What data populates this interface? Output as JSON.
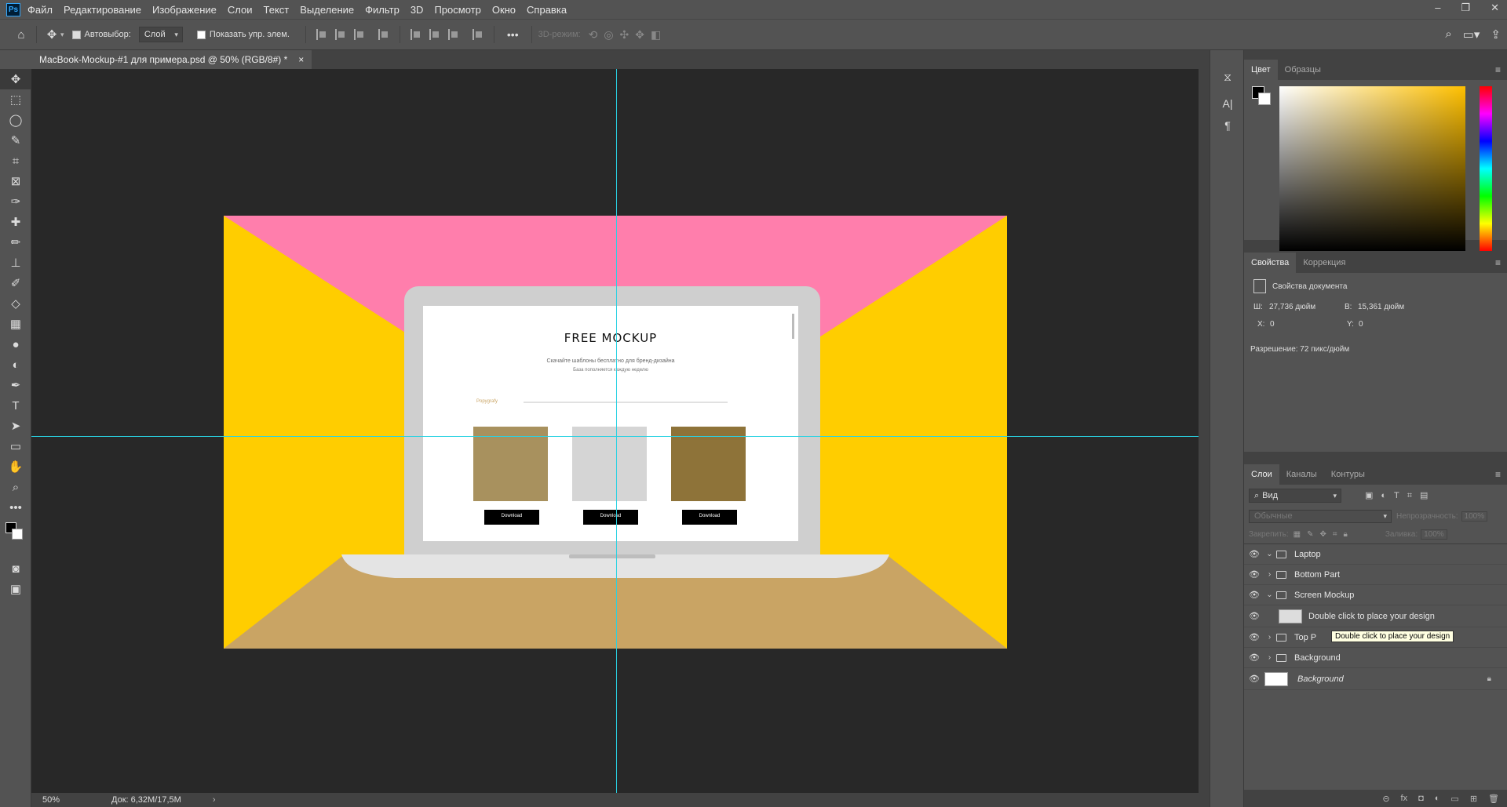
{
  "app": {
    "logo": "Ps"
  },
  "menu": [
    "Файл",
    "Редактирование",
    "Изображение",
    "Слои",
    "Текст",
    "Выделение",
    "Фильтр",
    "3D",
    "Просмотр",
    "Окно",
    "Справка"
  ],
  "window_controls": [
    "–",
    "❐",
    "✕"
  ],
  "options": {
    "auto_select_label": "Автовыбор:",
    "auto_select_value": "Слой",
    "show_controls_label": "Показать упр. элем.",
    "more": "•••",
    "mode3d_label": "3D-режим:"
  },
  "document_tab": {
    "title": "MacBook-Mockup-#1 для примера.psd @ 50% (RGB/8#) *",
    "close": "×"
  },
  "mockup": {
    "title": "FREE MOCKUP",
    "subtitle_1": "Скачайте шаблоны бесплатно для бренд-дизайна",
    "subtitle_2": "База пополняется каждую неделю",
    "section_label": "Popygrafy",
    "download_labels": [
      "Download",
      "Download",
      "Download"
    ]
  },
  "status": {
    "zoom": "50%",
    "doc_info": "Док: 6,32M/17,5M"
  },
  "color_panel": {
    "tabs": [
      "Цвет",
      "Образцы"
    ]
  },
  "properties_panel": {
    "tabs": [
      "Свойства",
      "Коррекция"
    ],
    "heading": "Свойства документа",
    "w_label": "Ш:",
    "w_value": "27,736 дюйм",
    "h_label": "В:",
    "h_value": "15,361 дюйм",
    "x_label": "X:",
    "x_value": "0",
    "y_label": "Y:",
    "y_value": "0",
    "resolution": "Разрешение: 72 пикс/дюйм"
  },
  "layers_panel": {
    "tabs": [
      "Слои",
      "Каналы",
      "Контуры"
    ],
    "filter_value": "Вид",
    "blend_mode": "Обычные",
    "opacity_label": "Непрозрачность:",
    "opacity_value": "100%",
    "lock_label": "Закрепить:",
    "fill_label": "Заливка:",
    "fill_value": "100%",
    "layers": [
      {
        "name": "Laptop"
      },
      {
        "name": "Bottom Part"
      },
      {
        "name": "Screen Mockup"
      },
      {
        "name": "Double click to place your design"
      },
      {
        "name": "Top P"
      },
      {
        "name": "Background"
      },
      {
        "name": "Background"
      }
    ],
    "tooltip": "Double click to place your design"
  },
  "colors": {
    "accent": "#29d2e3",
    "pink": "#ff7eac",
    "yellow": "#ffcd00",
    "floor": "#c9a464"
  }
}
